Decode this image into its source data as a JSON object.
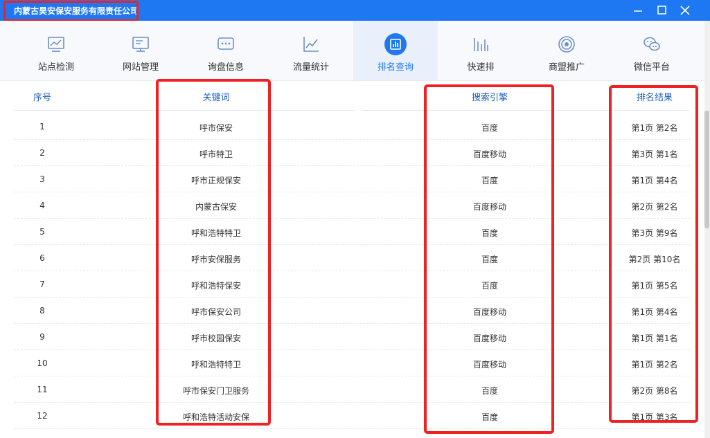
{
  "window": {
    "title": "内蒙古昊安保安服务有限责任公司"
  },
  "icons": {
    "minimize": "minimize-icon",
    "maximize": "maximize-icon",
    "close": "close-icon"
  },
  "colors": {
    "titlebar": "#1e78f2",
    "accent": "#1f78f0",
    "highlight": "#ee2222"
  },
  "nav": {
    "active_index": 4,
    "items": [
      {
        "label": "站点检测",
        "icon": "monitor-chart-icon"
      },
      {
        "label": "网站管理",
        "icon": "desktop-icon"
      },
      {
        "label": "询盘信息",
        "icon": "chat-dots-icon"
      },
      {
        "label": "流量统计",
        "icon": "line-chart-icon"
      },
      {
        "label": "排名查询",
        "icon": "bar-chart-icon"
      },
      {
        "label": "快速排",
        "icon": "bars-icon"
      },
      {
        "label": "商盟推广",
        "icon": "target-icon"
      },
      {
        "label": "微信平台",
        "icon": "wechat-icon"
      }
    ]
  },
  "table": {
    "headers": {
      "no": "序号",
      "keyword": "关键词",
      "engine": "搜索引擎",
      "rank": "排名结果"
    },
    "rows": [
      {
        "no": "1",
        "keyword": "呼市保安",
        "engine": "百度",
        "rank": "第1页 第2名"
      },
      {
        "no": "2",
        "keyword": "呼市特卫",
        "engine": "百度移动",
        "rank": "第3页 第1名"
      },
      {
        "no": "3",
        "keyword": "呼市正规保安",
        "engine": "百度",
        "rank": "第1页 第4名"
      },
      {
        "no": "4",
        "keyword": "内蒙古保安",
        "engine": "百度移动",
        "rank": "第2页 第2名"
      },
      {
        "no": "5",
        "keyword": "呼和浩特特卫",
        "engine": "百度",
        "rank": "第3页 第9名"
      },
      {
        "no": "6",
        "keyword": "呼市安保服务",
        "engine": "百度",
        "rank": "第2页 第10名"
      },
      {
        "no": "7",
        "keyword": "呼和浩特保安",
        "engine": "百度",
        "rank": "第1页 第5名"
      },
      {
        "no": "8",
        "keyword": "呼市保安公司",
        "engine": "百度移动",
        "rank": "第1页 第4名"
      },
      {
        "no": "9",
        "keyword": "呼市校园保安",
        "engine": "百度移动",
        "rank": "第1页 第1名"
      },
      {
        "no": "10",
        "keyword": "呼和浩特特卫",
        "engine": "百度移动",
        "rank": "第1页 第2名"
      },
      {
        "no": "11",
        "keyword": "呼市保安门卫服务",
        "engine": "百度",
        "rank": "第2页 第8名"
      },
      {
        "no": "12",
        "keyword": "呼和浩特活动安保",
        "engine": "百度",
        "rank": "第1页 第3名"
      }
    ]
  }
}
